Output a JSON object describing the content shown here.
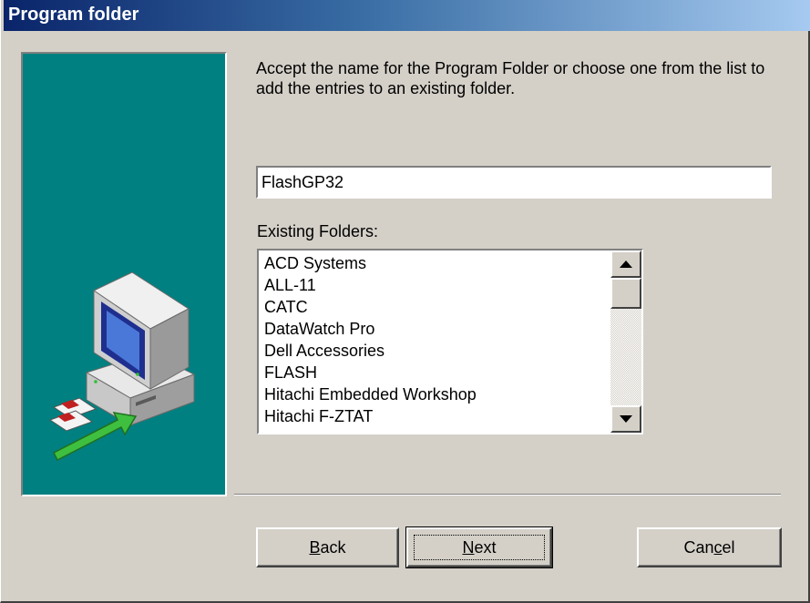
{
  "window": {
    "title": "Program folder"
  },
  "instruction": "Accept the name for the Program Folder or choose one from the list to add the entries to an existing folder.",
  "folder_name": {
    "value": "FlashGP32"
  },
  "existing_folders": {
    "label": "Existing Folders:",
    "items": [
      "ACD Systems",
      "ALL-11",
      "CATC",
      "DataWatch Pro",
      "Dell Accessories",
      "FLASH",
      "Hitachi Embedded Workshop",
      "Hitachi F-ZTAT"
    ]
  },
  "buttons": {
    "back": {
      "pre": "",
      "key": "B",
      "post": "ack"
    },
    "next": {
      "pre": "",
      "key": "N",
      "post": "ext"
    },
    "cancel": {
      "pre": "Can",
      "key": "c",
      "post": "el"
    }
  },
  "colors": {
    "panel": "#008080",
    "title_start": "#0a246a",
    "title_end": "#a6caf0",
    "face": "#d4d0c8"
  }
}
